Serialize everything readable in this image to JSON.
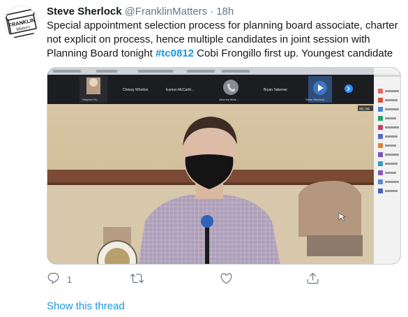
{
  "tweet": {
    "display_name": "Steve Sherlock",
    "handle": "@FranklinMatters",
    "separator": "·",
    "time": "18h",
    "text_part1": "Special appointment selection process for planning board associate, charter not explicit on process, hence multiple candidates in joint session with Planning Board tonight ",
    "hashtag": "#tc0812",
    "text_part2": " Cobi Frongillo first up.  Youngest candidate",
    "avatar": {
      "line1": "FRANKLIN",
      "line2": "Matters"
    },
    "reply_count": "1",
    "show_thread": "Show this thread"
  },
  "video": {
    "participants": [
      "Stephen Sh...",
      "Chrissy Whelton",
      "Eamon McCarth...",
      "Attorney Mark ...",
      "Bryan Taberner",
      "Steve Sherlock"
    ],
    "timer": "00:00",
    "sidebar_count": 12
  },
  "icons": {
    "reply": "reply-icon",
    "retweet": "retweet-icon",
    "like": "heart-icon",
    "share": "share-icon"
  },
  "colors": {
    "link": "#1b95e0",
    "secondary": "#657786",
    "text": "#14171a"
  }
}
